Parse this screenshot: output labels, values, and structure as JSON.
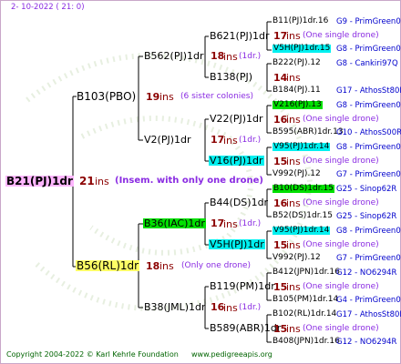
{
  "header": {
    "date": "2- 10-2022 ( 21: 0)"
  },
  "footer": {
    "copyright": "Copyright 2004-2022 © Karl Kehrle Foundation",
    "website": "www.pedigreeapis.org"
  },
  "tree": {
    "root": {
      "id": "B21(PJ)1dr",
      "ins": "21",
      "ins_label": "ins",
      "note": "(Insem. with only one drone)"
    },
    "gen2": [
      {
        "id": "B103(PBO)",
        "ins": "19",
        "ins_label": "ins",
        "note": "(6 sister colonies)"
      },
      {
        "id": "B56(RL)1dr",
        "ins": "18",
        "ins_label": "ins",
        "note": "(Only one drone)"
      }
    ],
    "gen3": [
      {
        "id": "B562(PJ)1dr",
        "ins": "18",
        "ins_label": "ins",
        "note": "(1dr.)"
      },
      {
        "id": "V2(PJ)1dr",
        "ins": "17",
        "ins_label": "ins",
        "note": "(1dr.)"
      },
      {
        "id": "B36(IAC)1dr",
        "ins": "17",
        "ins_label": "ins",
        "note": "(1dr.)"
      },
      {
        "id": "B38(JML)1dr",
        "ins": "16",
        "ins_label": "ins",
        "note": "(1dr.)"
      }
    ],
    "gen4": [
      {
        "id": "B621(PJ)1dr"
      },
      {
        "id": "B138(PJ)",
        "ins": "14",
        "ins_label": "ins"
      },
      {
        "id": "V22(PJ)1dr",
        "ins": "16",
        "ins_label": "ins",
        "note": "(1dr.)"
      },
      {
        "id": "V16(PJ)1dr"
      },
      {
        "id": "B44(DS)1dr",
        "ins": "17",
        "ins_label": "ins",
        "note": "(1dr.)"
      },
      {
        "id": "V5H(PJ)1dr"
      },
      {
        "id": "B119(PM)1dr"
      },
      {
        "id": "B589(ABR)1dr",
        "ins": "15",
        "ins_label": "ins",
        "note": "(1dr.)"
      }
    ],
    "gen5": [
      {
        "id": "B11(PJ)1dr.16",
        "pcode": "G9 - PrimGreen00"
      },
      {
        "ins": "17",
        "ins_label": "ins",
        "note": "(One single drone)"
      },
      {
        "id": "V5H(PJ)1dr.15",
        "pcode": "G8 - PrimGreen00"
      },
      {
        "id": "B222(PJ).12",
        "pcode": "G8 - Cankiri97Q"
      },
      {
        "id": "B184(PJ).11",
        "pcode": "G17 - AthosSt80R"
      },
      {
        "id": "V216(PJ).13",
        "pcode": "G8 - PrimGreen00"
      },
      {
        "ins": "16",
        "ins_label": "ins",
        "note": "(One single drone)"
      },
      {
        "id": "B595(ABR)1dr.13",
        "pcode": "G10 - AthosS00R"
      },
      {
        "id": "V95(PJ)1dr.14",
        "pcode": "G8 - PrimGreen00"
      },
      {
        "ins": "15",
        "ins_label": "ins",
        "note": "(One single drone)"
      },
      {
        "id": "V992(PJ).12",
        "pcode": "G7 - PrimGreen00"
      },
      {
        "id": "B10(DS)1dr.15",
        "pcode": "G25 - Sinop62R"
      },
      {
        "ins": "16",
        "ins_label": "ins",
        "note": "(One single drone)"
      },
      {
        "id": "B52(DS)1dr.15",
        "pcode": "G25 - Sinop62R"
      },
      {
        "id": "V95(PJ)1dr.14",
        "pcode": "G8 - PrimGreen00"
      },
      {
        "ins": "15",
        "ins_label": "ins",
        "note": "(One single drone)"
      },
      {
        "id": "V992(PJ).12",
        "pcode": "G7 - PrimGreen00"
      },
      {
        "id": "B412(JPN)1dr.16",
        "pcode": "G12 - NO6294R"
      },
      {
        "ins": "15",
        "ins_label": "ins",
        "note": "(One single drone)"
      },
      {
        "id": "B105(PM)1dr.14",
        "pcode": "G4 - PrimGreen00"
      },
      {
        "id": "B102(RL)1dr.14",
        "pcode": "G17 - AthosSt80R"
      },
      {
        "ins": "15",
        "ins_label": "ins",
        "note": "(One single drone)"
      },
      {
        "id": "B408(JPN)1dr.16",
        "pcode": "G12 - NO6294R"
      }
    ]
  },
  "colors": {
    "root_highlight": "#ffb6ff",
    "yellow_highlight": "#ffff66",
    "green_highlight": "#00e000",
    "cyan_highlight": "#00f0f0",
    "ins_color": "#8b0000",
    "note_color": "#8a2be2",
    "pcode_color": "#0000cc",
    "header_color": "#8a2be2",
    "footer_color": "#006400"
  }
}
